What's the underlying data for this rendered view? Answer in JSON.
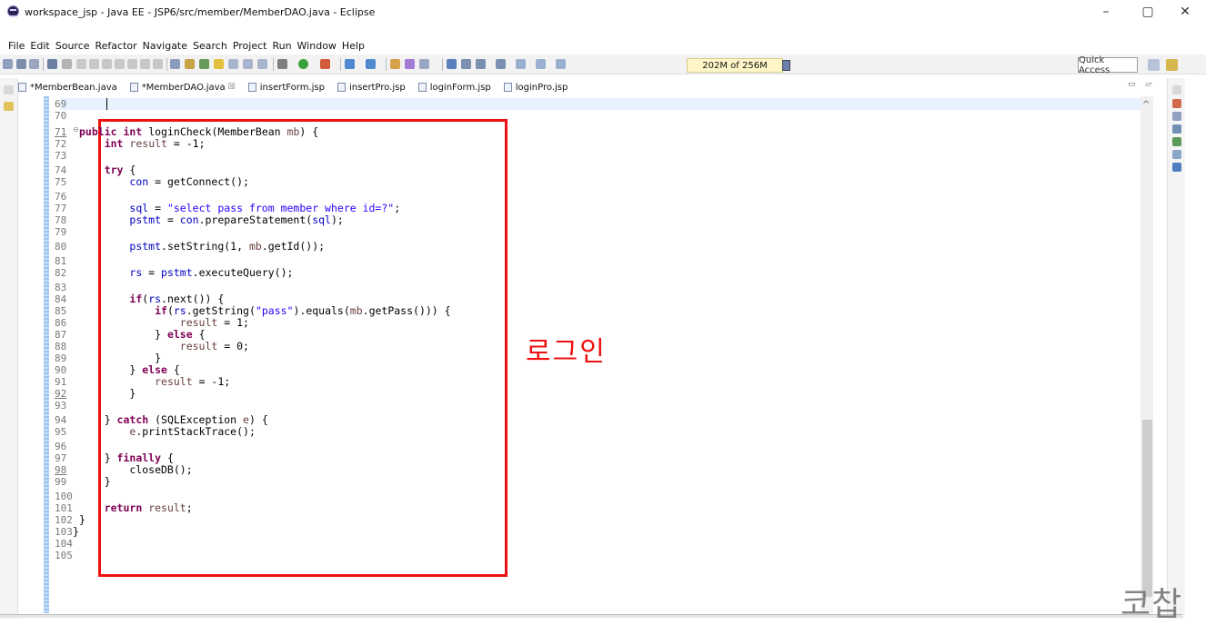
{
  "window": {
    "title": "workspace_jsp - Java EE - JSP6/src/member/MemberDAO.java - Eclipse",
    "minimize": "–",
    "maximize": "▢",
    "close": "✕"
  },
  "menu": [
    "File",
    "Edit",
    "Source",
    "Refactor",
    "Navigate",
    "Search",
    "Project",
    "Run",
    "Window",
    "Help"
  ],
  "toolbar": {
    "memory": "202M of 256M",
    "quick_access": "Quick Access"
  },
  "tabs": [
    {
      "label": "*MemberBean.java",
      "active": false
    },
    {
      "label": "*MemberDAO.java",
      "active": true,
      "close": "☒"
    },
    {
      "label": "insertForm.jsp",
      "active": false
    },
    {
      "label": "insertPro.jsp",
      "active": false
    },
    {
      "label": "loginForm.jsp",
      "active": false
    },
    {
      "label": "loginPro.jsp",
      "active": false
    }
  ],
  "tab_controls": "▭ ▱",
  "gutter": [
    "69",
    "70",
    "71",
    "72",
    "73",
    "74",
    "75",
    "76",
    "77",
    "78",
    "79",
    "80",
    "81",
    "82",
    "83",
    "84",
    "85",
    "86",
    "87",
    "88",
    "89",
    "90",
    "91",
    "92",
    "93",
    "94",
    "95",
    "96",
    "97",
    "98",
    "99",
    "100",
    "101",
    "102",
    "103",
    "104",
    "105"
  ],
  "annotation": "로그인",
  "watermark": "코찹",
  "scroll_arrow": "^",
  "fold_marker": "⊖"
}
